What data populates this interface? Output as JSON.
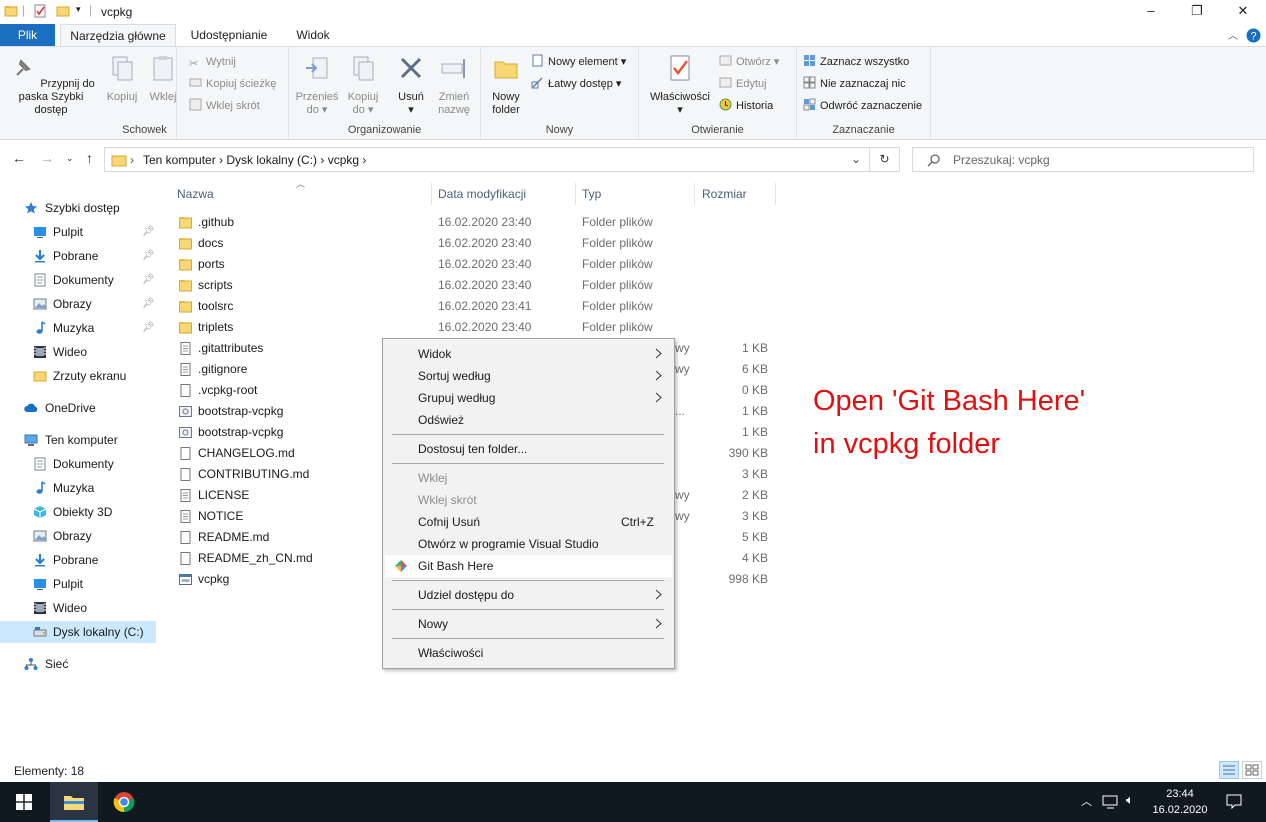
{
  "window": {
    "title": "vcpkg",
    "min": "–",
    "max": "❐",
    "close": "✕"
  },
  "tabs": [
    "Plik",
    "Narzędzia główne",
    "Udostępnianie",
    "Widok"
  ],
  "ribbon": {
    "schowek": {
      "label": "Schowek",
      "pin": "Przypnij do paska Szybki dostęp",
      "copy": "Kopiuj",
      "paste": "Wklej",
      "cut": "Wytnij",
      "copy_path": "Kopiuj ścieżkę",
      "paste_shortcut": "Wklej skrót"
    },
    "organizowanie": {
      "label": "Organizowanie",
      "move": "Przenieś do",
      "copy_to": "Kopiuj do",
      "delete": "Usuń",
      "rename": "Zmień nazwę"
    },
    "nowy": {
      "label": "Nowy",
      "new_folder": "Nowy folder",
      "new_item": "Nowy element",
      "easy_access": "Łatwy dostęp"
    },
    "otwieranie": {
      "label": "Otwieranie",
      "properties": "Właściwości",
      "open": "Otwórz",
      "edit": "Edytuj",
      "history": "Historia"
    },
    "zaznaczanie": {
      "label": "Zaznaczanie",
      "select_all": "Zaznacz wszystko",
      "select_none": "Nie zaznaczaj nic",
      "invert": "Odwróć zaznaczenie"
    }
  },
  "address": {
    "crumbs": "Ten komputer  ›  Dysk lokalny (C:)  ›  vcpkg  ›",
    "search_placeholder": "Przeszukaj: vcpkg"
  },
  "nav": [
    {
      "label": "Szybki dostęp",
      "icon": "star-icon"
    },
    {
      "label": "Pulpit",
      "icon": "desktop-icon",
      "pinned": true
    },
    {
      "label": "Pobrane",
      "icon": "download-icon",
      "pinned": true
    },
    {
      "label": "Dokumenty",
      "icon": "documents-icon",
      "pinned": true
    },
    {
      "label": "Obrazy",
      "icon": "pictures-icon",
      "pinned": true
    },
    {
      "label": "Muzyka",
      "icon": "music-icon",
      "pinned": true
    },
    {
      "label": "Wideo",
      "icon": "video-icon"
    },
    {
      "label": "Zrzuty ekranu",
      "icon": "folder-icon"
    },
    {
      "label": "OneDrive",
      "icon": "cloud-icon"
    },
    {
      "label": "Ten komputer",
      "icon": "computer-icon"
    },
    {
      "label": "Dokumenty",
      "icon": "documents-icon"
    },
    {
      "label": "Muzyka",
      "icon": "music-icon"
    },
    {
      "label": "Obiekty 3D",
      "icon": "3d-objects-icon"
    },
    {
      "label": "Obrazy",
      "icon": "pictures-icon"
    },
    {
      "label": "Pobrane",
      "icon": "download-icon"
    },
    {
      "label": "Pulpit",
      "icon": "desktop-icon"
    },
    {
      "label": "Wideo",
      "icon": "video-icon"
    },
    {
      "label": "Dysk lokalny (C:)",
      "icon": "drive-icon"
    },
    {
      "label": "Sieć",
      "icon": "network-icon"
    }
  ],
  "columns": [
    "Nazwa",
    "Data modyfikacji",
    "Typ",
    "Rozmiar"
  ],
  "files": [
    {
      "name": ".github",
      "date": "16.02.2020 23:40",
      "type": "Folder plików",
      "size": "",
      "kind": "folder"
    },
    {
      "name": "docs",
      "date": "16.02.2020 23:40",
      "type": "Folder plików",
      "size": "",
      "kind": "folder"
    },
    {
      "name": "ports",
      "date": "16.02.2020 23:40",
      "type": "Folder plików",
      "size": "",
      "kind": "folder"
    },
    {
      "name": "scripts",
      "date": "16.02.2020 23:40",
      "type": "Folder plików",
      "size": "",
      "kind": "folder"
    },
    {
      "name": "toolsrc",
      "date": "16.02.2020 23:41",
      "type": "Folder plików",
      "size": "",
      "kind": "folder"
    },
    {
      "name": "triplets",
      "date": "16.02.2020 23:40",
      "type": "Folder plików",
      "size": "",
      "kind": "folder"
    },
    {
      "name": ".gitattributes",
      "date": "",
      "type": "wy",
      "size": "1 KB",
      "kind": "file"
    },
    {
      "name": ".gitignore",
      "date": "",
      "type": "wy",
      "size": "6 KB",
      "kind": "file"
    },
    {
      "name": ".vcpkg-root",
      "date": "",
      "type": "",
      "size": "0 KB",
      "kind": "blank"
    },
    {
      "name": "bootstrap-vcpkg",
      "date": "",
      "type": "...",
      "size": "1 KB",
      "kind": "script"
    },
    {
      "name": "bootstrap-vcpkg",
      "date": "",
      "type": "",
      "size": "1 KB",
      "kind": "script"
    },
    {
      "name": "CHANGELOG.md",
      "date": "",
      "type": "",
      "size": "390 KB",
      "kind": "blank"
    },
    {
      "name": "CONTRIBUTING.md",
      "date": "",
      "type": "",
      "size": "3 KB",
      "kind": "blank"
    },
    {
      "name": "LICENSE",
      "date": "",
      "type": "wy",
      "size": "2 KB",
      "kind": "file"
    },
    {
      "name": "NOTICE",
      "date": "",
      "type": "wy",
      "size": "3 KB",
      "kind": "file"
    },
    {
      "name": "README.md",
      "date": "",
      "type": "",
      "size": "5 KB",
      "kind": "blank"
    },
    {
      "name": "README_zh_CN.md",
      "date": "",
      "type": "",
      "size": "4 KB",
      "kind": "blank"
    },
    {
      "name": "vcpkg",
      "date": "",
      "type": "",
      "size": "998 KB",
      "kind": "exe"
    }
  ],
  "context_menu": [
    {
      "label": "Widok",
      "submenu": true
    },
    {
      "label": "Sortuj według",
      "submenu": true
    },
    {
      "label": "Grupuj według",
      "submenu": true
    },
    {
      "label": "Odśwież"
    },
    {
      "sep": true
    },
    {
      "label": "Dostosuj ten folder..."
    },
    {
      "sep": true
    },
    {
      "label": "Wklej",
      "disabled": true
    },
    {
      "label": "Wklej skrót",
      "disabled": true
    },
    {
      "label": "Cofnij Usuń",
      "accel": "Ctrl+Z"
    },
    {
      "label": "Otwórz w programie Visual Studio"
    },
    {
      "label": "Git Bash Here",
      "icon": "git-icon",
      "hover": true
    },
    {
      "sep": true
    },
    {
      "label": "Udziel dostępu do",
      "submenu": true
    },
    {
      "sep": true
    },
    {
      "label": "Nowy",
      "submenu": true
    },
    {
      "sep": true
    },
    {
      "label": "Właściwości"
    }
  ],
  "annotation": {
    "line1": "Open 'Git Bash Here'",
    "line2": "in vcpkg folder"
  },
  "status": "Elementy: 18",
  "clock": {
    "time": "23:44",
    "date": "16.02.2020"
  },
  "colors": {
    "accent": "#1a6fc0",
    "folder": "#f8d775",
    "annotation": "#e01010",
    "taskbar": "#101820"
  }
}
